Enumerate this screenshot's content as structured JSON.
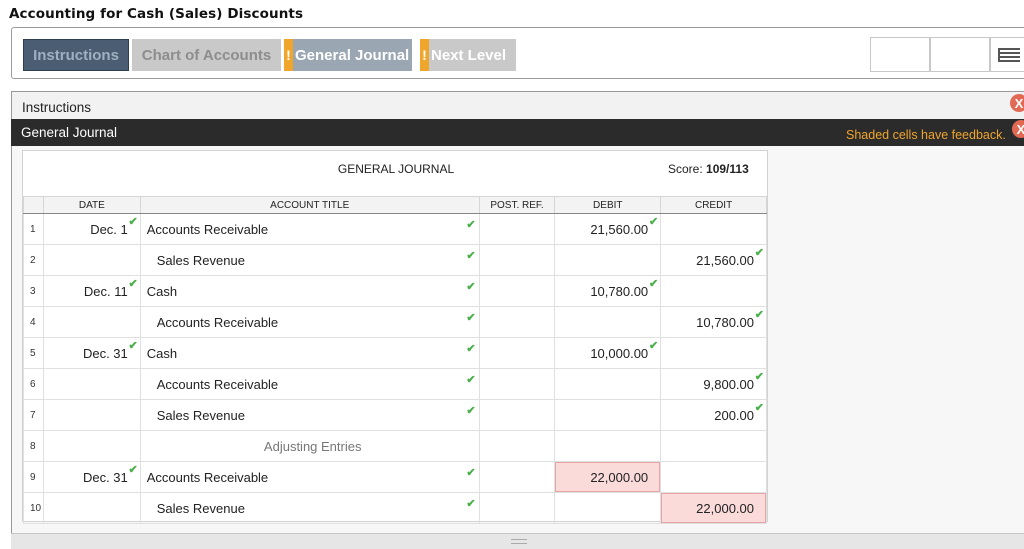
{
  "page": {
    "title": "Accounting for Cash (Sales) Discounts"
  },
  "toolbar": {
    "instructions_label": "Instructions",
    "chart_label": "Chart of Accounts",
    "journal_label": "General Journal",
    "next_label": "Next Level",
    "flag_glyph": "!"
  },
  "panels": {
    "instructions": "Instructions",
    "general_journal": "General Journal",
    "feedback_note": "Shaded cells have feedback.",
    "close_glyph": "X"
  },
  "journal": {
    "title": "GENERAL JOURNAL",
    "score_label": "Score:",
    "score_value": "109/113",
    "columns": [
      "DATE",
      "ACCOUNT TITLE",
      "POST. REF.",
      "DEBIT",
      "CREDIT"
    ],
    "rows": [
      {
        "num": "1",
        "date": "Dec. 1",
        "account": "Accounts Receivable",
        "post_ref": "",
        "debit": "21,560.00",
        "credit": ""
      },
      {
        "num": "2",
        "date": "",
        "account": "Sales Revenue",
        "post_ref": "",
        "debit": "",
        "credit": "21,560.00"
      },
      {
        "num": "3",
        "date": "Dec. 11",
        "account": "Cash",
        "post_ref": "",
        "debit": "10,780.00",
        "credit": ""
      },
      {
        "num": "4",
        "date": "",
        "account": "Accounts Receivable",
        "post_ref": "",
        "debit": "",
        "credit": "10,780.00"
      },
      {
        "num": "5",
        "date": "Dec. 31",
        "account": "Cash",
        "post_ref": "",
        "debit": "10,000.00",
        "credit": ""
      },
      {
        "num": "6",
        "date": "",
        "account": "Accounts Receivable",
        "post_ref": "",
        "debit": "",
        "credit": "9,800.00"
      },
      {
        "num": "7",
        "date": "",
        "account": "Sales Revenue",
        "post_ref": "",
        "debit": "",
        "credit": "200.00"
      },
      {
        "num": "8",
        "date": "",
        "account": "Adjusting Entries",
        "post_ref": "",
        "debit": "",
        "credit": ""
      },
      {
        "num": "9",
        "date": "Dec. 31",
        "account": "Accounts Receivable",
        "post_ref": "",
        "debit": "22,000.00",
        "credit": ""
      },
      {
        "num": "10",
        "date": "",
        "account": "Sales Revenue",
        "post_ref": "",
        "debit": "",
        "credit": "22,000.00"
      }
    ]
  },
  "colors": {
    "check": "#4bb04b",
    "wrong_cell": "#fbdada",
    "accent_flag": "#f0a52c",
    "feedback_text": "#f0a52c"
  },
  "icons": {
    "check": "check-icon",
    "menu": "menu-icon",
    "close": "close-icon",
    "flag": "warning-flag-icon"
  }
}
